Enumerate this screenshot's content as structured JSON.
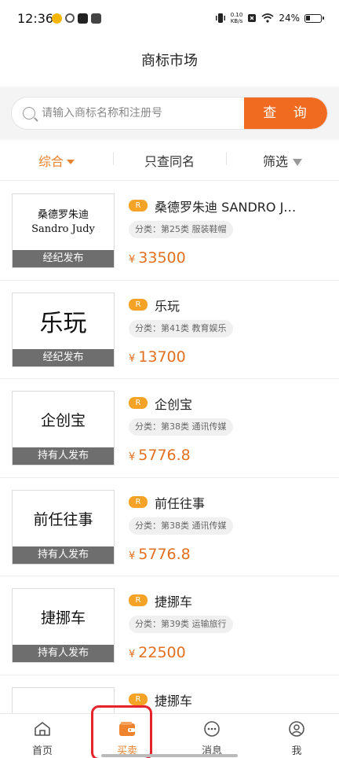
{
  "status_bar": {
    "time": "12:36",
    "net_speed_value": "0.10",
    "net_speed_unit": "KB/s",
    "battery": "24%"
  },
  "page": {
    "title": "商标市场"
  },
  "search": {
    "placeholder": "请输入商标名称和注册号",
    "button_label": "查 询"
  },
  "filters": {
    "tabs": [
      {
        "label": "综合",
        "active": true
      },
      {
        "label": "只查同名",
        "active": false
      },
      {
        "label": "筛选",
        "active": false
      }
    ]
  },
  "listings": [
    {
      "thumb_line1": "桑德罗朱迪",
      "thumb_line2": "Sandro Judy",
      "publisher": "经纪发布",
      "badge": "R",
      "name": "桑德罗朱迪 SANDRO J…",
      "category": "分类：第25类 服装鞋帽",
      "currency": "¥",
      "price": "33500"
    },
    {
      "thumb_line1": "乐玩",
      "publisher": "经纪发布",
      "badge": "R",
      "name": "乐玩",
      "category": "分类：第41类 教育娱乐",
      "currency": "¥",
      "price": "13700"
    },
    {
      "thumb_line1": "企创宝",
      "publisher": "持有人发布",
      "badge": "R",
      "name": "企创宝",
      "category": "分类：第38类 通讯传媒",
      "currency": "¥",
      "price": "5776.8"
    },
    {
      "thumb_line1": "前任往事",
      "publisher": "持有人发布",
      "badge": "R",
      "name": "前任往事",
      "category": "分类：第38类 通讯传媒",
      "currency": "¥",
      "price": "5776.8"
    },
    {
      "thumb_line1": "捷挪车",
      "publisher": "持有人发布",
      "badge": "R",
      "name": "捷挪车",
      "category": "分类：第39类 运输旅行",
      "currency": "¥",
      "price": "22500"
    },
    {
      "badge": "R",
      "name": "捷挪车"
    }
  ],
  "bottom_nav": {
    "items": [
      {
        "label": "首页",
        "icon": "home-icon"
      },
      {
        "label": "买卖",
        "icon": "wallet-icon",
        "active": true
      },
      {
        "label": "消息",
        "icon": "chat-icon"
      },
      {
        "label": "我",
        "icon": "profile-icon"
      }
    ]
  },
  "colors": {
    "accent": "#f06a1f",
    "active_text": "#e8822e",
    "badge": "#f4a326",
    "highlight_box": "#e5242c"
  }
}
